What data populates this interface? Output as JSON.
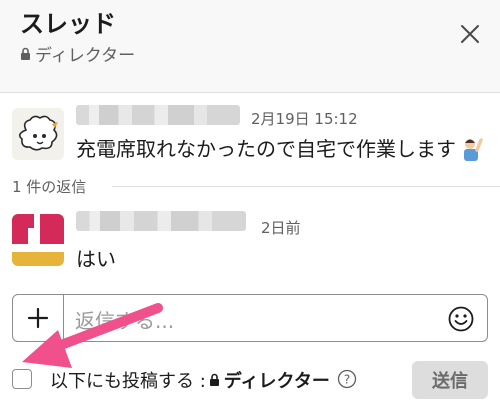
{
  "header": {
    "title": "スレッド",
    "channel": "ディレクター"
  },
  "parent_message": {
    "timestamp": "2月19日 15:12",
    "text": "充電席取れなかったので自宅で作業します"
  },
  "replies": {
    "label": "1 件の返信"
  },
  "reply_message": {
    "timestamp": "2日前",
    "text": "はい"
  },
  "composer": {
    "placeholder": "返信する..."
  },
  "also_post": {
    "label": "以下にも投稿する :",
    "channel": "ディレクター"
  },
  "send_button": {
    "label": "送信"
  },
  "colors": {
    "annotation_arrow": "#f0508c",
    "send_button_bg": "#dddddd"
  }
}
